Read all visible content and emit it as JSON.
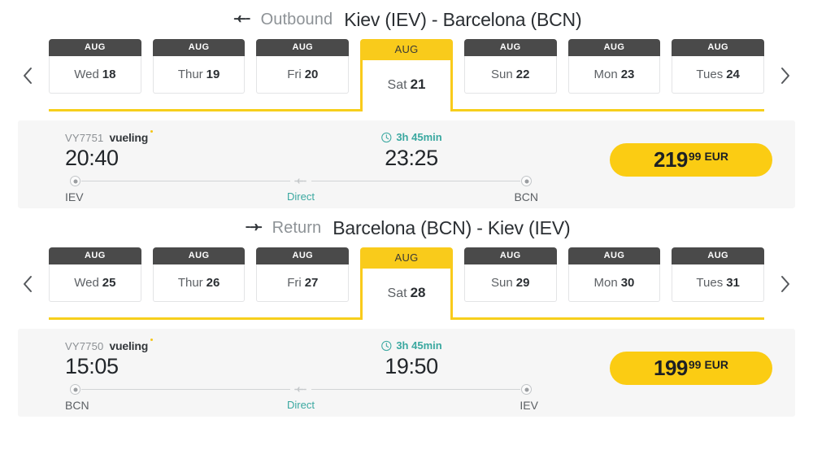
{
  "sections": [
    {
      "icon": "plane-departure-icon",
      "label": "Outbound",
      "route": "Kiev (IEV) - Barcelona (BCN)",
      "nav": {
        "prev": "chevron-left-icon",
        "next": "chevron-right-icon"
      },
      "tabs": [
        {
          "month": "AUG",
          "dow": "Wed",
          "day": "18",
          "active": false
        },
        {
          "month": "AUG",
          "dow": "Thur",
          "day": "19",
          "active": false
        },
        {
          "month": "AUG",
          "dow": "Fri",
          "day": "20",
          "active": false
        },
        {
          "month": "AUG",
          "dow": "Sat",
          "day": "21",
          "active": true
        },
        {
          "month": "AUG",
          "dow": "Sun",
          "day": "22",
          "active": false
        },
        {
          "month": "AUG",
          "dow": "Mon",
          "day": "23",
          "active": false
        },
        {
          "month": "AUG",
          "dow": "Tues",
          "day": "24",
          "active": false
        }
      ],
      "flight": {
        "flight_number": "VY7751",
        "airline": "vueling",
        "depart_time": "20:40",
        "arrive_time": "23:25",
        "duration": "3h 45min",
        "origin": "IEV",
        "destination": "BCN",
        "stops": "Direct",
        "price_whole": "219",
        "price_cents": "99",
        "currency": "EUR"
      }
    },
    {
      "icon": "plane-arrival-icon",
      "label": "Return",
      "route": "Barcelona (BCN) - Kiev (IEV)",
      "nav": {
        "prev": "chevron-left-icon",
        "next": "chevron-right-icon"
      },
      "tabs": [
        {
          "month": "AUG",
          "dow": "Wed",
          "day": "25",
          "active": false
        },
        {
          "month": "AUG",
          "dow": "Thur",
          "day": "26",
          "active": false
        },
        {
          "month": "AUG",
          "dow": "Fri",
          "day": "27",
          "active": false
        },
        {
          "month": "AUG",
          "dow": "Sat",
          "day": "28",
          "active": true
        },
        {
          "month": "AUG",
          "dow": "Sun",
          "day": "29",
          "active": false
        },
        {
          "month": "AUG",
          "dow": "Mon",
          "day": "30",
          "active": false
        },
        {
          "month": "AUG",
          "dow": "Tues",
          "day": "31",
          "active": false
        }
      ],
      "flight": {
        "flight_number": "VY7750",
        "airline": "vueling",
        "depart_time": "15:05",
        "arrive_time": "19:50",
        "duration": "3h 45min",
        "origin": "BCN",
        "destination": "IEV",
        "stops": "Direct",
        "price_whole": "199",
        "price_cents": "99",
        "currency": "EUR"
      }
    }
  ],
  "colors": {
    "accent_yellow": "#f9cb1b",
    "price_yellow": "#fbcc13",
    "tab_header_dark": "#4a4a4a",
    "teal": "#3aa8a0",
    "card_bg": "#f6f6f6"
  }
}
